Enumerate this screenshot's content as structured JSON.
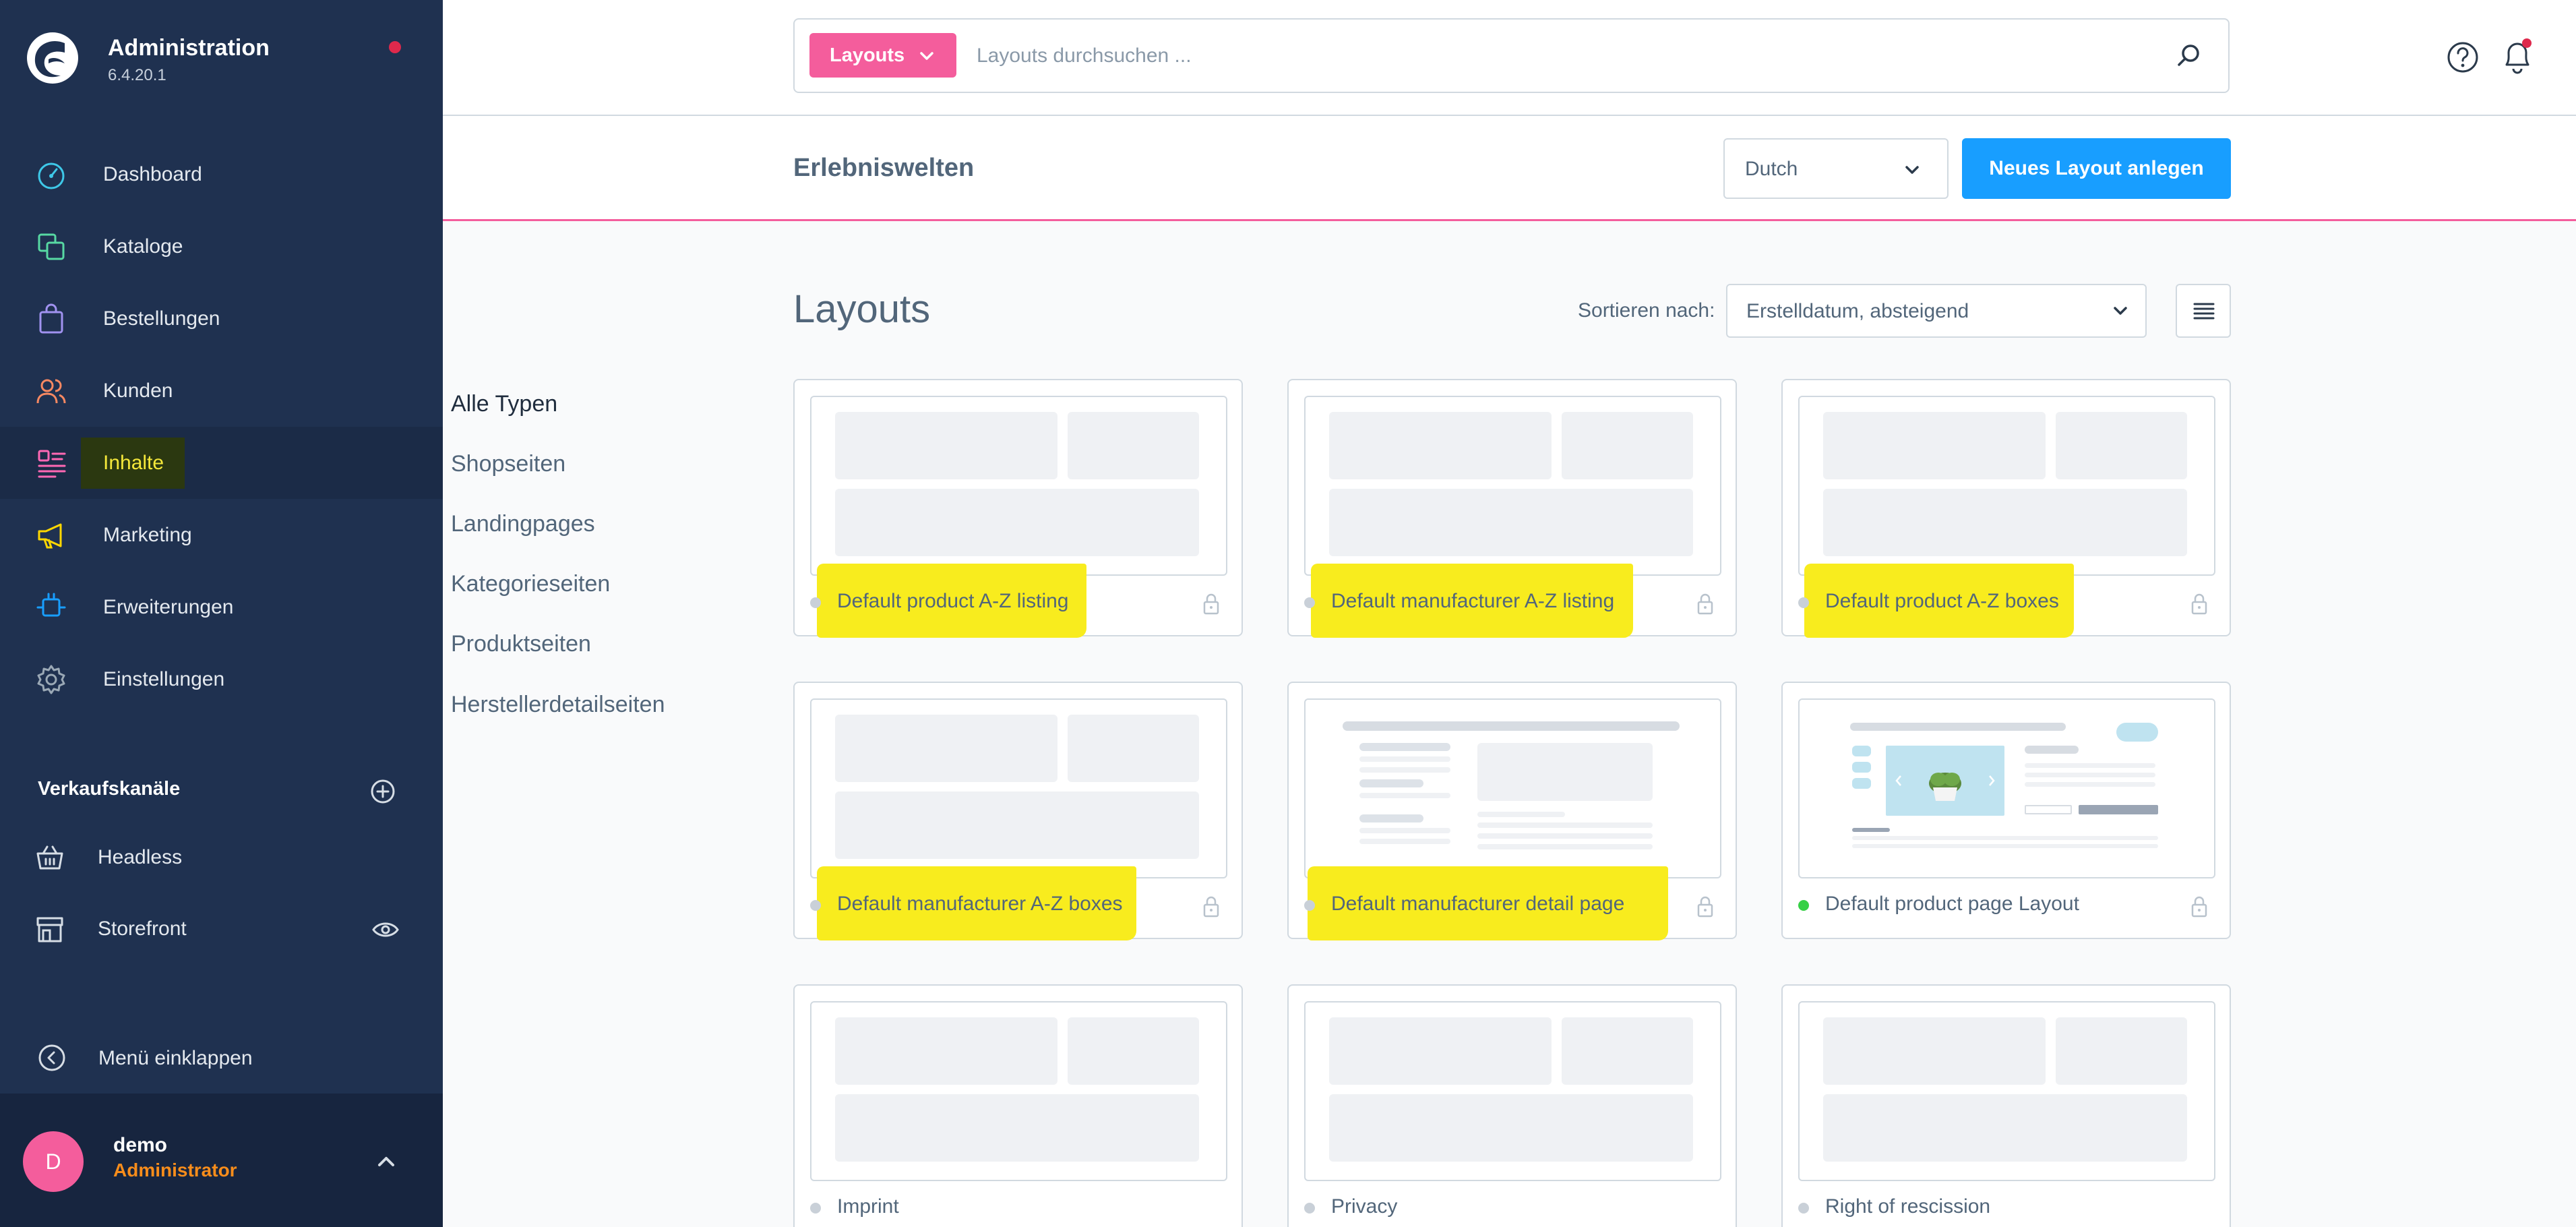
{
  "app": {
    "title": "Administration",
    "version": "6.4.20.1"
  },
  "nav": {
    "items": [
      {
        "label": "Dashboard",
        "icon": "dashboard-icon",
        "color": "#3ec8e8"
      },
      {
        "label": "Kataloge",
        "icon": "catalog-icon",
        "color": "#57d9a3"
      },
      {
        "label": "Bestellungen",
        "icon": "orders-icon",
        "color": "#a092f0"
      },
      {
        "label": "Kunden",
        "icon": "customers-icon",
        "color": "#f88962"
      },
      {
        "label": "Inhalte",
        "icon": "content-icon",
        "color": "#ff68b4",
        "active": true
      },
      {
        "label": "Marketing",
        "icon": "marketing-icon",
        "color": "#ffd700"
      },
      {
        "label": "Erweiterungen",
        "icon": "extensions-icon",
        "color": "#189eff"
      },
      {
        "label": "Einstellungen",
        "icon": "settings-icon",
        "color": "#9aa8b5"
      }
    ]
  },
  "sales_channels": {
    "title": "Verkaufskanäle",
    "items": [
      {
        "label": "Headless",
        "icon": "basket-icon"
      },
      {
        "label": "Storefront",
        "icon": "storefront-icon"
      }
    ]
  },
  "collapse_label": "Menü einklappen",
  "user": {
    "initial": "D",
    "name": "demo",
    "role": "Administrator"
  },
  "search": {
    "type_label": "Layouts",
    "placeholder": "Layouts durchsuchen ..."
  },
  "smartbar": {
    "title": "Erlebniswelten",
    "language": "Dutch",
    "create_button": "Neues Layout anlegen"
  },
  "content": {
    "title": "Layouts",
    "sort_label": "Sortieren nach:",
    "sort_value": "Erstelldatum, absteigend"
  },
  "filters": [
    "Alle Typen",
    "Shopseiten",
    "Landingpages",
    "Kategorieseiten",
    "Produktseiten",
    "Herstellerdetailseiten"
  ],
  "layouts": [
    {
      "name": "Default product A-Z listing",
      "status": "inactive",
      "locked": true,
      "preview": "listing",
      "highlighted": true
    },
    {
      "name": "Default manufacturer A-Z listing",
      "status": "inactive",
      "locked": true,
      "preview": "listing",
      "highlighted": true
    },
    {
      "name": "Default product A-Z boxes",
      "status": "inactive",
      "locked": true,
      "preview": "listing",
      "highlighted": true
    },
    {
      "name": "Default manufacturer A-Z boxes",
      "status": "inactive",
      "locked": true,
      "preview": "listing",
      "highlighted": true
    },
    {
      "name": "Default manufacturer detail page",
      "status": "inactive",
      "locked": true,
      "preview": "manufacturer",
      "highlighted": true
    },
    {
      "name": "Default product page Layout",
      "status": "active",
      "locked": true,
      "preview": "product",
      "highlighted": false
    },
    {
      "name": "Imprint",
      "status": "inactive",
      "locked": false,
      "preview": "listing",
      "highlighted": false
    },
    {
      "name": "Privacy",
      "status": "inactive",
      "locked": false,
      "preview": "listing",
      "highlighted": false
    },
    {
      "name": "Right of rescission",
      "status": "inactive",
      "locked": false,
      "preview": "listing",
      "highlighted": false
    }
  ]
}
